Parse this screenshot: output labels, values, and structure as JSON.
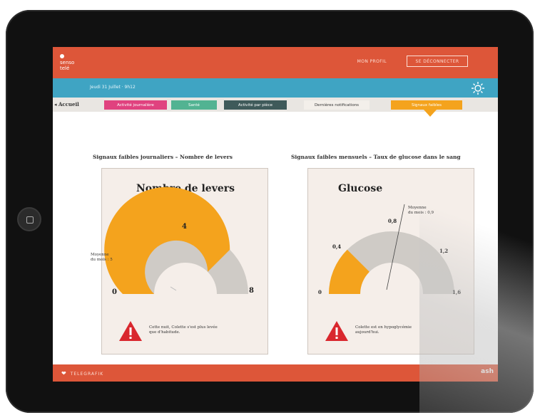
{
  "header": {
    "logo_text": "senso\ntelé",
    "nav_link": "MON PROFIL",
    "logout_label": "SE DÉCONNECTER"
  },
  "datebar": {
    "date": "Jeudi 31 Juillet · 9h12"
  },
  "tabs": {
    "home": "Accueil",
    "items": [
      {
        "label": "Activité journalière",
        "color": "#e0427f"
      },
      {
        "label": "Santé",
        "color": "#52b392"
      },
      {
        "label": "Activité par pièce",
        "color": "#3f5a5a"
      },
      {
        "label": "Dernières notifications",
        "color": "#f3efea"
      },
      {
        "label": "Signaux faibles",
        "color": "#f4a31d"
      }
    ]
  },
  "panels": {
    "left": {
      "title": "Signaux faibles journaliers – Nombre de levers",
      "card_title": "Nombre de levers",
      "min_label": "0",
      "mid_label": "4",
      "max_label": "8",
      "value": 4,
      "max": 8,
      "avg_note": "Moyenne\ndu mois : 5",
      "alert": "Cette nuit, Colette s'est plus levée\nque d'habitude."
    },
    "right": {
      "title": "Signaux faibles mensuels – Taux de glucose dans le sang",
      "card_title": "Glucose",
      "ticks": [
        "0",
        "0,4",
        "0,8",
        "1,2",
        "1,6"
      ],
      "value": 0.4,
      "max": 1.6,
      "avg_note": "Moyenne\ndu mois : 0,9",
      "alert": "Colette est en hypoglycémie\naujourd'hui."
    }
  },
  "footer": {
    "label": "TELEGRAFIK",
    "logo": "ash"
  },
  "colors": {
    "orange": "#f4a31d",
    "grey": "#cfcbc6",
    "red": "#dd5639",
    "blue": "#3fa4c3",
    "alert_red": "#d9272e"
  }
}
